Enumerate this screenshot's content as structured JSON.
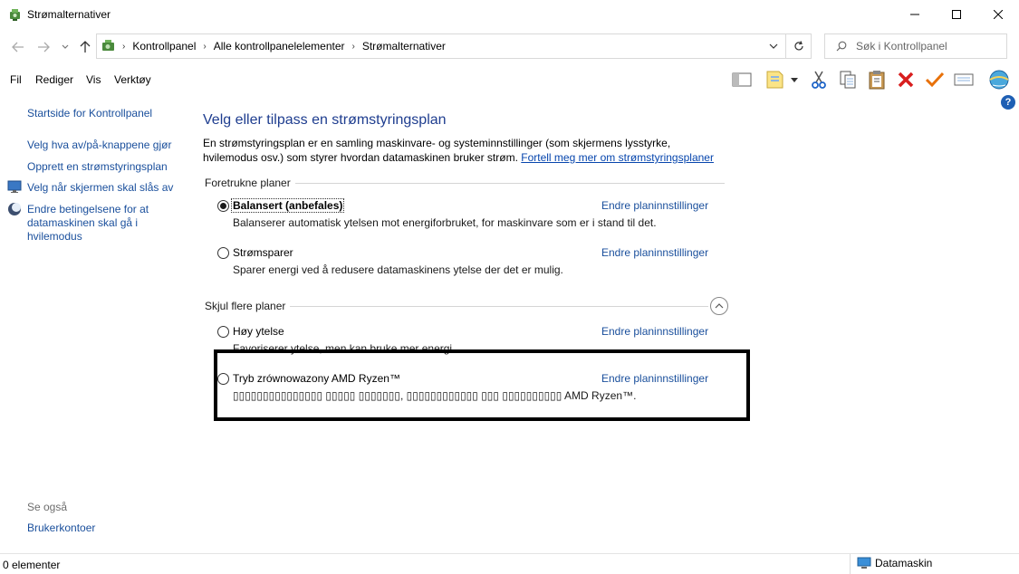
{
  "window": {
    "title": "Strømalternativer",
    "controls": {
      "minimize": "minimize",
      "maximize": "maximize",
      "close": "close"
    }
  },
  "address": {
    "crumbs": [
      "Kontrollpanel",
      "Alle kontrollpanelelementer",
      "Strømalternativer"
    ],
    "search_placeholder": "Søk i Kontrollpanel"
  },
  "menu": {
    "items": [
      "Fil",
      "Rediger",
      "Vis",
      "Verktøy"
    ]
  },
  "toolbar_icons": [
    "pane-icon",
    "folder-view-icon",
    "cut-icon",
    "copy-icon",
    "paste-icon",
    "delete-icon",
    "checkmark-icon",
    "properties-icon",
    "globe-icon"
  ],
  "sidebar": {
    "items": [
      {
        "label": "Startside for Kontrollpanel"
      },
      {
        "label": "Velg hva av/på-knappene gjør"
      },
      {
        "label": "Opprett en strømstyringsplan"
      },
      {
        "label": "Velg når skjermen skal slås av"
      },
      {
        "label": "Endre betingelsene for at datamaskinen skal gå i hvilemodus"
      }
    ],
    "see_also": "Se også",
    "see_also_links": [
      "Brukerkontoer"
    ]
  },
  "main": {
    "title": "Velg eller tilpass en strømstyringsplan",
    "description": "En strømstyringsplan er en samling maskinvare- og systeminnstillinger (som skjermens lysstyrke, hvilemodus osv.) som styrer hvordan datamaskinen bruker strøm.",
    "learn_more": "Fortell meg mer om strømstyringsplaner",
    "preferred_heading": "Foretrukne planer",
    "more_heading": "Skjul flere planer",
    "change_label": "Endre planinnstillinger",
    "plans": [
      {
        "name": "Balansert (anbefales)",
        "desc": "Balanserer automatisk ytelsen mot energiforbruket, for maskinvare som er i stand til det.",
        "selected": true
      },
      {
        "name": "Strømsparer",
        "desc": "Sparer energi ved å redusere datamaskinens ytelse der det er mulig.",
        "selected": false
      },
      {
        "name": "Høy ytelse",
        "desc": "Favoriserer ytelse, men kan bruke mer energi.",
        "selected": false
      },
      {
        "name": "Tryb zrównowazony AMD Ryzen™",
        "desc": "▯▯▯▯▯▯▯▯▯▯▯▯▯▯▯ ▯▯▯▯▯ ▯▯▯▯▯▯▯, ▯▯▯▯▯▯▯▯▯▯▯▯ ▯▯▯ ▯▯▯▯▯▯▯▯▯▯ AMD Ryzen™.",
        "selected": false
      }
    ]
  },
  "status": {
    "left": "0 elementer",
    "right": "Datamaskin"
  }
}
